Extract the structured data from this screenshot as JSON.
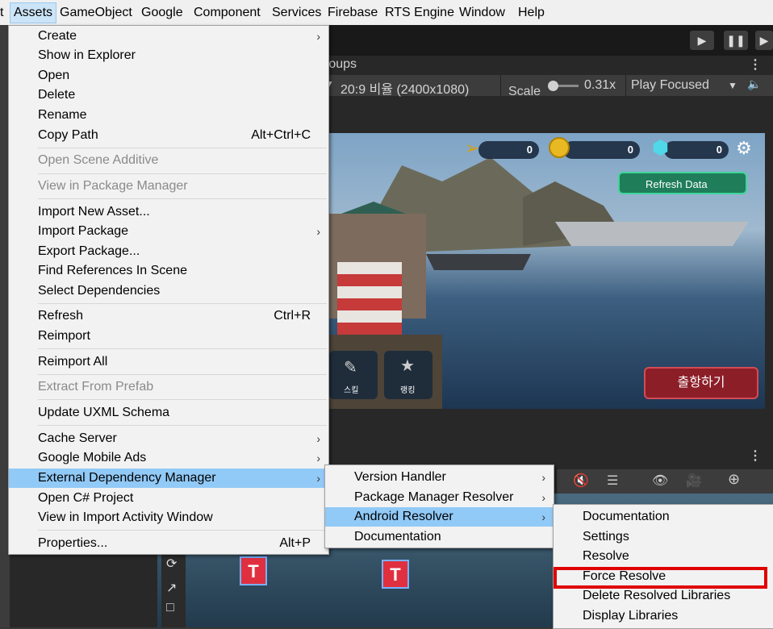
{
  "menubar": {
    "items": [
      "t",
      "Assets",
      "GameObject",
      "Google",
      "Component",
      "Services",
      "Firebase",
      "RTS Engine",
      "Window",
      "Help"
    ]
  },
  "editor": {
    "tab_title": "roups",
    "aspect_label": "20:9 비율 (2400x1080)",
    "scale_label": "Scale",
    "scale_value": "0.31x",
    "play_mode": "Play Focused",
    "game": {
      "ammo": "0",
      "coins": "0",
      "gems": "0",
      "refresh_button": "Refresh Data",
      "sortie_button": "출항하기",
      "skill_label": "스킬",
      "ranking_label": "랭킹"
    }
  },
  "assets_menu": {
    "items": [
      {
        "label": "Create",
        "submenu": true
      },
      {
        "label": "Show in Explorer"
      },
      {
        "label": "Open"
      },
      {
        "label": "Delete"
      },
      {
        "label": "Rename"
      },
      {
        "label": "Copy Path",
        "shortcut": "Alt+Ctrl+C"
      },
      {
        "label": "Open Scene Additive",
        "disabled": true
      },
      {
        "label": "View in Package Manager",
        "disabled": true
      },
      {
        "label": "Import New Asset..."
      },
      {
        "label": "Import Package",
        "submenu": true
      },
      {
        "label": "Export Package..."
      },
      {
        "label": "Find References In Scene"
      },
      {
        "label": "Select Dependencies"
      },
      {
        "label": "Refresh",
        "shortcut": "Ctrl+R"
      },
      {
        "label": "Reimport"
      },
      {
        "label": "Reimport All"
      },
      {
        "label": "Extract From Prefab",
        "disabled": true
      },
      {
        "label": "Update UXML Schema"
      },
      {
        "label": "Cache Server",
        "submenu": true
      },
      {
        "label": "Google Mobile Ads",
        "submenu": true
      },
      {
        "label": "External Dependency Manager",
        "submenu": true,
        "highlighted": true
      },
      {
        "label": "Open C# Project"
      },
      {
        "label": "View in Import Activity Window"
      },
      {
        "label": "Properties...",
        "shortcut": "Alt+P"
      }
    ]
  },
  "edm_menu": {
    "items": [
      {
        "label": "Version Handler",
        "submenu": true
      },
      {
        "label": "Package Manager Resolver",
        "submenu": true
      },
      {
        "label": "Android Resolver",
        "submenu": true,
        "highlighted": true
      },
      {
        "label": "Documentation"
      }
    ]
  },
  "android_menu": {
    "items": [
      {
        "label": "Documentation"
      },
      {
        "label": "Settings"
      },
      {
        "label": "Resolve"
      },
      {
        "label": "Force Resolve",
        "boxed": true
      },
      {
        "label": "Delete Resolved Libraries"
      },
      {
        "label": "Display Libraries"
      }
    ]
  },
  "colors": {
    "highlight": "#91c9f7",
    "callout": "#e00000",
    "menu_bg": "#f2f2f2"
  }
}
